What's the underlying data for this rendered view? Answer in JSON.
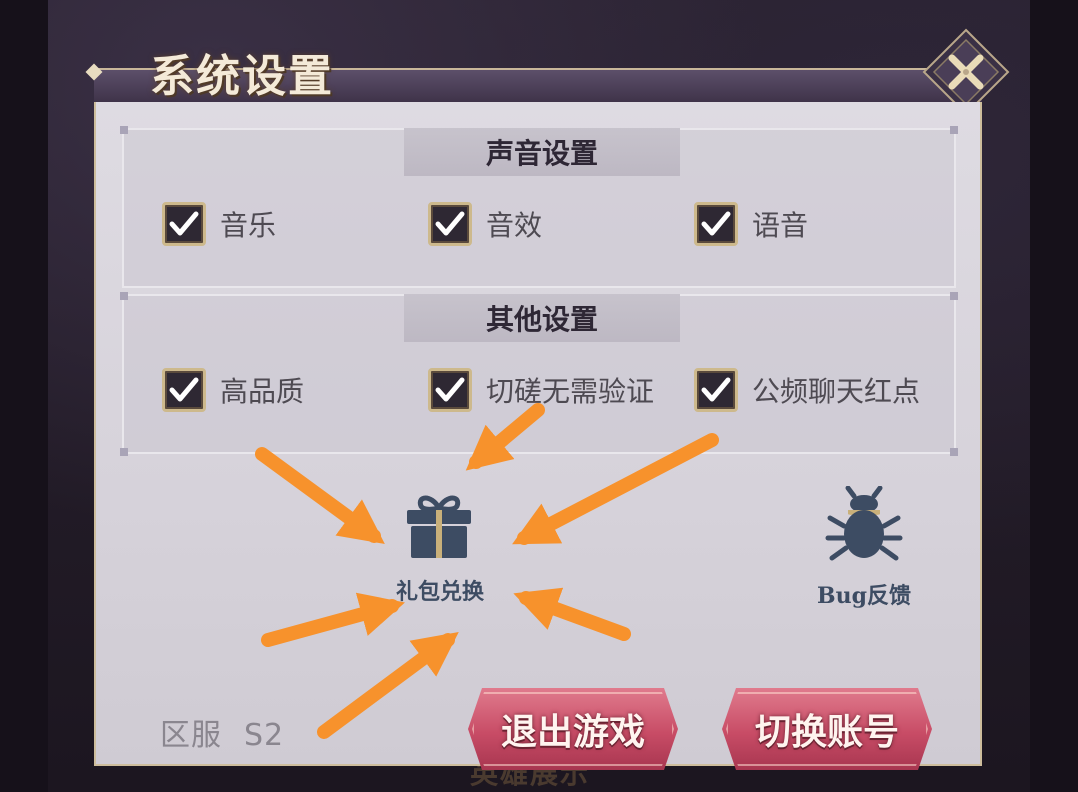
{
  "background": {
    "under_text": "英雄展示"
  },
  "dialog": {
    "title": "系统设置",
    "close_icon": "close-x-icon"
  },
  "sections": {
    "sound": {
      "heading": "声音设置",
      "options": [
        {
          "label": "音乐",
          "checked": true
        },
        {
          "label": "音效",
          "checked": true
        },
        {
          "label": "语音",
          "checked": true
        }
      ]
    },
    "other": {
      "heading": "其他设置",
      "options": [
        {
          "label": "高品质",
          "checked": true
        },
        {
          "label": "切磋无需验证",
          "checked": true
        },
        {
          "label": "公频聊天红点",
          "checked": true
        }
      ]
    }
  },
  "actions": {
    "gift": {
      "label": "礼包兑换",
      "icon": "gift-icon"
    },
    "bug": {
      "label": "Bug反馈",
      "icon": "bug-icon"
    }
  },
  "server": {
    "label": "区服",
    "value": "S2"
  },
  "buttons": {
    "exit": "退出游戏",
    "switch": "切换账号"
  },
  "colors": {
    "accent_button": "#c84c66",
    "icon_blue": "#3d4c63",
    "annotation_arrow": "#f7922c",
    "checkbox_border": "#cdb98c"
  }
}
